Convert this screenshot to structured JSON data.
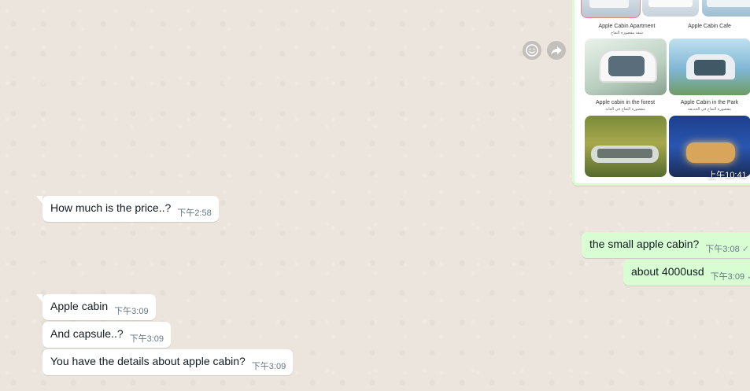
{
  "image_message": {
    "captions": [
      {
        "title": "Apple Cabin Apartment",
        "sub": "شقة مقصورة التفاح"
      },
      {
        "title": "Apple Cabin Cafe",
        "sub": ""
      },
      {
        "title": "Apple cabin in the forest",
        "sub": "مقصورة التفاح في الغابة"
      },
      {
        "title": "Apple Cabin in the Park",
        "sub": "مقصورة التفاح في الحديقة"
      }
    ],
    "time": "上午10:41"
  },
  "messages": [
    {
      "direction": "in",
      "text": "How much is the price..?",
      "time": "下午2:58"
    },
    {
      "direction": "out",
      "text": "the small apple cabin?",
      "time": "下午3:08"
    },
    {
      "direction": "out",
      "text": "about 4000usd",
      "time": "下午3:09"
    },
    {
      "direction": "in",
      "text": "Apple cabin",
      "time": "下午3:09"
    },
    {
      "direction": "in",
      "text": "And capsule..?",
      "time": "下午3:09"
    },
    {
      "direction": "in",
      "text": "You have the details about apple cabin?",
      "time": "下午3:09"
    }
  ],
  "icons": {
    "emoji_button": "smile-icon",
    "forward_button": "forward-icon",
    "read_receipt": "check-icon"
  },
  "colors": {
    "chat_background": "#ece5dd",
    "incoming_bubble": "#ffffff",
    "outgoing_bubble": "#d9fdd3",
    "timestamp": "#667781"
  }
}
